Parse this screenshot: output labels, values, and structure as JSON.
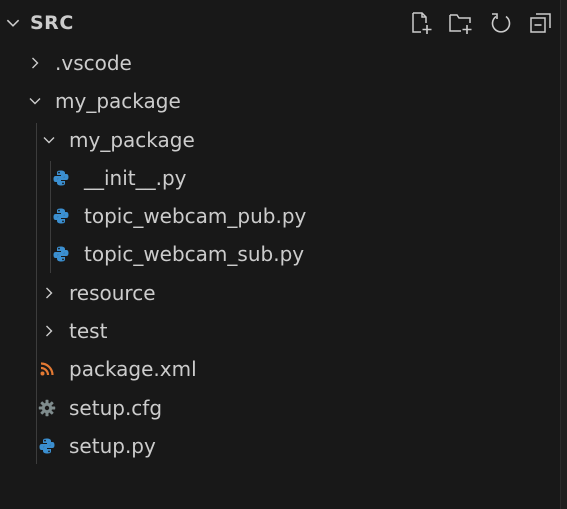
{
  "header": {
    "title": "SRC",
    "actions": [
      {
        "name": "new-file-button",
        "icon": "new-file-icon"
      },
      {
        "name": "new-folder-button",
        "icon": "new-folder-icon"
      },
      {
        "name": "refresh-button",
        "icon": "refresh-icon"
      },
      {
        "name": "collapse-all-button",
        "icon": "collapse-all-icon"
      }
    ]
  },
  "tree": {
    "items": [
      {
        "label": ".vscode",
        "type": "folder",
        "expanded": false
      },
      {
        "label": "my_package",
        "type": "folder",
        "expanded": true
      },
      {
        "label": "my_package",
        "type": "folder",
        "expanded": true
      },
      {
        "label": "__init__.py",
        "type": "file",
        "icon": "python-icon"
      },
      {
        "label": "topic_webcam_pub.py",
        "type": "file",
        "icon": "python-icon"
      },
      {
        "label": "topic_webcam_sub.py",
        "type": "file",
        "icon": "python-icon"
      },
      {
        "label": "resource",
        "type": "folder",
        "expanded": false
      },
      {
        "label": "test",
        "type": "folder",
        "expanded": false
      },
      {
        "label": "package.xml",
        "type": "file",
        "icon": "rss-icon"
      },
      {
        "label": "setup.cfg",
        "type": "file",
        "icon": "gear-icon"
      },
      {
        "label": "setup.py",
        "type": "file",
        "icon": "python-icon"
      }
    ]
  },
  "colors": {
    "background": "#181818",
    "text": "#cccccc",
    "python": "#3b8fd0",
    "xml": "#e37933",
    "gear": "#7f8c8d"
  }
}
